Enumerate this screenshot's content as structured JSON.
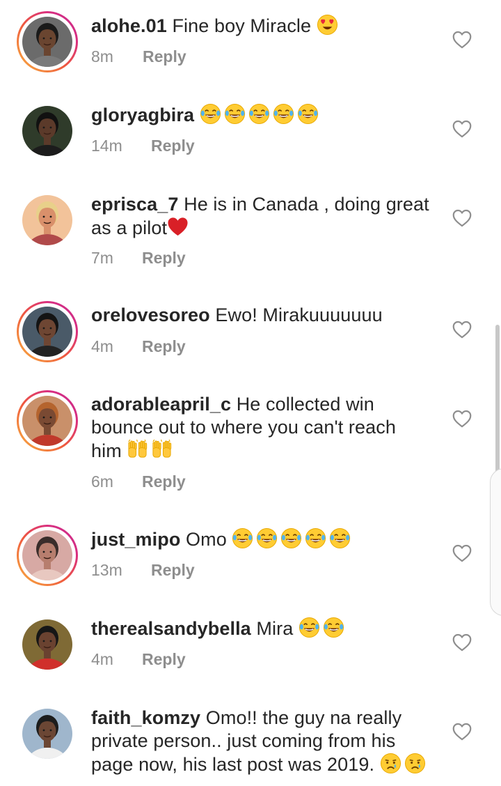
{
  "comments": [
    {
      "username": "alohe.01",
      "text": "Fine boy Miracle",
      "emojis": [
        "heart-eyes"
      ],
      "time": "8m",
      "reply_label": "Reply",
      "story_ring": true,
      "avatar": {
        "bg": "#6b6b6b",
        "skin": "#6a4530",
        "hair": "#1a1a1a",
        "cloth": "#7a7a7a"
      }
    },
    {
      "username": "gloryagbira",
      "text": "",
      "emojis": [
        "joy",
        "joy",
        "joy",
        "joy",
        "joy"
      ],
      "time": "14m",
      "reply_label": "Reply",
      "story_ring": false,
      "avatar": {
        "bg": "#2f3b2a",
        "skin": "#5b3a2a",
        "hair": "#111111",
        "cloth": "#1c1c1c"
      }
    },
    {
      "username": "eprisca_7",
      "text": "He is in Canada , doing great as a pilot",
      "emojis": [
        "red-heart"
      ],
      "time": "7m",
      "reply_label": "Reply",
      "story_ring": false,
      "avatar": {
        "bg": "#f2c39a",
        "skin": "#d9906b",
        "hair": "#e8d08a",
        "cloth": "#b04a4a"
      }
    },
    {
      "username": "orelovesoreo",
      "text": "Ewo! Mirakuuuuuuu",
      "emojis": [],
      "time": "4m",
      "reply_label": "Reply",
      "story_ring": true,
      "avatar": {
        "bg": "#4a5a68",
        "skin": "#6e4633",
        "hair": "#141414",
        "cloth": "#222222"
      }
    },
    {
      "username": "adorableapril_c",
      "text": "He collected win bounce out to where you can't reach him",
      "emojis": [
        "raising-hands",
        "raising-hands"
      ],
      "time": "6m",
      "reply_label": "Reply",
      "story_ring": true,
      "avatar": {
        "bg": "#c9906a",
        "skin": "#7a4a33",
        "hair": "#b5642e",
        "cloth": "#c0392b"
      }
    },
    {
      "username": "just_mipo",
      "text": "Omo",
      "emojis": [
        "joy",
        "joy",
        "joy",
        "joy",
        "joy"
      ],
      "time": "13m",
      "reply_label": "Reply",
      "story_ring": true,
      "avatar": {
        "bg": "#d7a9a4",
        "skin": "#b77e6e",
        "hair": "#3a2d2a",
        "cloth": "#e8c8c0"
      }
    },
    {
      "username": "therealsandybella",
      "text": "Mira",
      "emojis": [
        "joy",
        "joy"
      ],
      "time": "4m",
      "reply_label": "Reply",
      "story_ring": false,
      "avatar": {
        "bg": "#7f6a35",
        "skin": "#6a4230",
        "hair": "#161616",
        "cloth": "#d0302b"
      }
    },
    {
      "username": "faith_komzy",
      "text": "Omo!! the guy na really private person.. just coming from his page now, his last post was 2019.",
      "emojis": [
        "crying",
        "crying"
      ],
      "time": "",
      "reply_label": "",
      "story_ring": false,
      "avatar": {
        "bg": "#9fb6cc",
        "skin": "#6b4634",
        "hair": "#1c1c1c",
        "cloth": "#f0f0f0"
      }
    }
  ],
  "colors": {
    "text": "#262626",
    "meta": "#8e8e8e",
    "story_ring": [
      "#f9b33f",
      "#d92e7f"
    ],
    "heart_outline": "#8e8e8e"
  },
  "icons": {
    "like": "heart-outline-icon"
  }
}
